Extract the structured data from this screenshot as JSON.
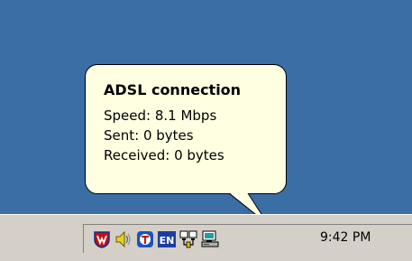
{
  "balloon": {
    "title": "ADSL connection",
    "lines": [
      "Speed: 8.1 Mbps",
      "Sent: 0 bytes",
      "Received: 0 bytes"
    ]
  },
  "taskbar": {
    "clock": "9:42 PM",
    "tray_icons": [
      {
        "name": "antivirus-shield-icon"
      },
      {
        "name": "volume-speaker-icon"
      },
      {
        "name": "app-tray-icon"
      },
      {
        "name": "language-indicator-icon",
        "text": "EN"
      },
      {
        "name": "network-connection-icon"
      },
      {
        "name": "adsl-connection-icon"
      }
    ]
  },
  "colors": {
    "desktop": "#3a6ea5",
    "taskbar": "#d4d0c8",
    "balloon": "#ffffe1",
    "lang_badge": "#1c3ea0"
  }
}
